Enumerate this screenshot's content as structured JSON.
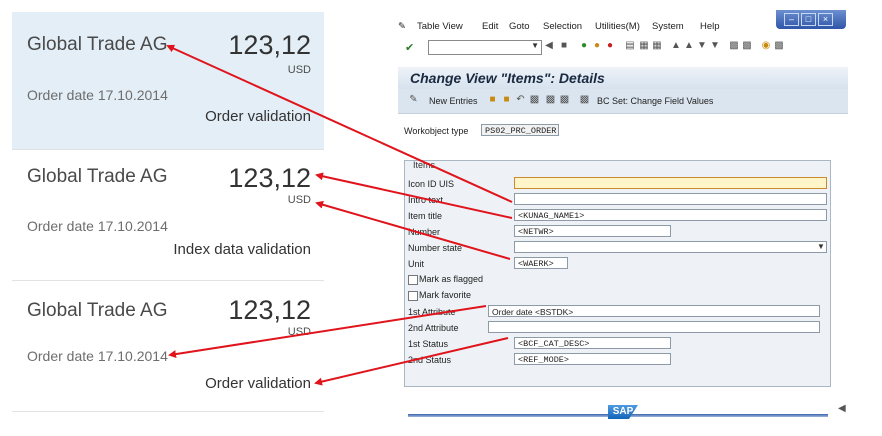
{
  "cards": [
    {
      "title": "Global Trade AG",
      "amount": "123,12",
      "currency": "USD",
      "date": "Order date 17.10.2014",
      "status": "Order validation"
    },
    {
      "title": "Global Trade AG",
      "amount": "123,12",
      "currency": "USD",
      "date": "Order date 17.10.2014",
      "status": "Index data validation"
    },
    {
      "title": "Global Trade AG",
      "amount": "123,12",
      "currency": "USD",
      "date": "Order date 17.10.2014",
      "status": "Order validation"
    }
  ],
  "sap": {
    "menu": {
      "table_view": "Table View",
      "edit": "Edit",
      "goto": "Goto",
      "selection": "Selection",
      "utilities": "Utilities(M)",
      "system": "System",
      "help": "Help"
    },
    "title": "Change View \"Items\": Details",
    "appbar": {
      "new_entries": "New Entries",
      "bcset": "BC Set: Change Field Values"
    },
    "workobject": {
      "label": "Workobject type",
      "value": "PS02_PRC_ORDER"
    },
    "group_title": "Items",
    "fields": {
      "icon_id": {
        "label": "Icon ID UIS",
        "value": ""
      },
      "intro_text": {
        "label": "Intro text",
        "value": ""
      },
      "item_title": {
        "label": "Item title",
        "value": "<KUNAG_NAME1>"
      },
      "number": {
        "label": "Number",
        "value": "<NETWR>"
      },
      "number_state": {
        "label": "Number state",
        "value": ""
      },
      "unit": {
        "label": "Unit",
        "value": "<WAERK>"
      },
      "mark_flagged": {
        "label": "Mark as flagged"
      },
      "mark_favorite": {
        "label": "Mark favorite"
      },
      "attr1": {
        "label": "1st Attribute",
        "value": "Order date <BSTDK>"
      },
      "attr2": {
        "label": "2nd Attribute",
        "value": ""
      },
      "status1": {
        "label": "1st Status",
        "value": "<BCF_CAT_DESC>"
      },
      "status2": {
        "label": "2nd Status",
        "value": "<REF_MODE>"
      }
    },
    "logo": "SAP"
  },
  "colors": {
    "arrow": "#e0141c",
    "selected_card": "#e3eef6",
    "required_field": "#fff5c8"
  },
  "icons": [
    "enter-icon",
    "save-icon",
    "back-icon",
    "exit-icon",
    "cancel-icon",
    "print-icon",
    "find-icon",
    "layout-icon",
    "help-icon",
    "pencil-icon",
    "copy-icon",
    "delete-icon"
  ]
}
